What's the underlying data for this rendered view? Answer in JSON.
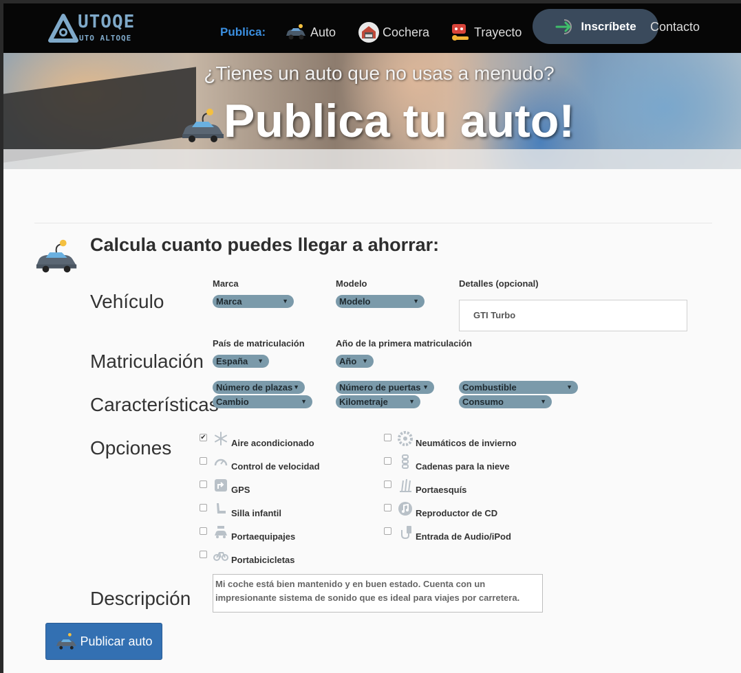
{
  "nav": {
    "logo_main": "UTOQE",
    "logo_sub": "UTO ALTOQE",
    "publica_label": "Publica:",
    "items": [
      {
        "label": "Auto",
        "icon": "car-icon"
      },
      {
        "label": "Cochera",
        "icon": "garage-icon"
      },
      {
        "label": "Trayecto",
        "icon": "route-icon"
      }
    ],
    "signup_label": "Inscríbete",
    "contact_label": "Contacto"
  },
  "hero": {
    "subtitle": "¿Tienes un auto que no usas a menudo?",
    "title": "Publica tu auto!"
  },
  "calc": {
    "title": "Calcula cuanto puedes llegar a ahorrar:"
  },
  "vehicle": {
    "section": "Vehículo",
    "brand_label": "Marca",
    "brand_value": "Marca",
    "model_label": "Modelo",
    "model_value": "Modelo",
    "details_label": "Detalles (opcional)",
    "details_value": "GTI Turbo"
  },
  "registration": {
    "section": "Matriculación",
    "country_label": "País de matriculación",
    "country_value": "España",
    "year_label": "Año de la primera matriculación",
    "year_value": "Año"
  },
  "features": {
    "section": "Características",
    "seats": "Número de plazas",
    "doors": "Número de puertas",
    "fuel": "Combustible",
    "gearbox": "Cambio",
    "mileage": "Kilometraje",
    "consumption": "Consumo"
  },
  "options": {
    "section": "Opciones",
    "left": [
      {
        "label": "Aire acondicionado",
        "checked": true,
        "icon": "snowflake-icon"
      },
      {
        "label": "Control de velocidad",
        "checked": false,
        "icon": "speedometer-icon"
      },
      {
        "label": "GPS",
        "checked": false,
        "icon": "gps-icon"
      },
      {
        "label": "Silla infantil",
        "checked": false,
        "icon": "child-seat-icon"
      },
      {
        "label": "Portaequipajes",
        "checked": false,
        "icon": "roof-rack-icon"
      },
      {
        "label": "Portabicicletas",
        "checked": false,
        "icon": "bicycle-icon"
      }
    ],
    "right": [
      {
        "label": "Neumáticos de invierno",
        "checked": false,
        "icon": "tire-icon"
      },
      {
        "label": "Cadenas para la nieve",
        "checked": false,
        "icon": "snow-chain-icon"
      },
      {
        "label": "Portaesquís",
        "checked": false,
        "icon": "ski-rack-icon"
      },
      {
        "label": "Reproductor de CD",
        "checked": false,
        "icon": "cd-icon"
      },
      {
        "label": "Entrada de Audio/iPod",
        "checked": false,
        "icon": "audio-input-icon"
      }
    ]
  },
  "description": {
    "section": "Descripción",
    "value": "Mi coche está bien mantenido y en buen estado. Cuenta con un impresionante sistema de sonido que es ideal para viajes por carretera."
  },
  "publish_button": "Publicar auto"
}
